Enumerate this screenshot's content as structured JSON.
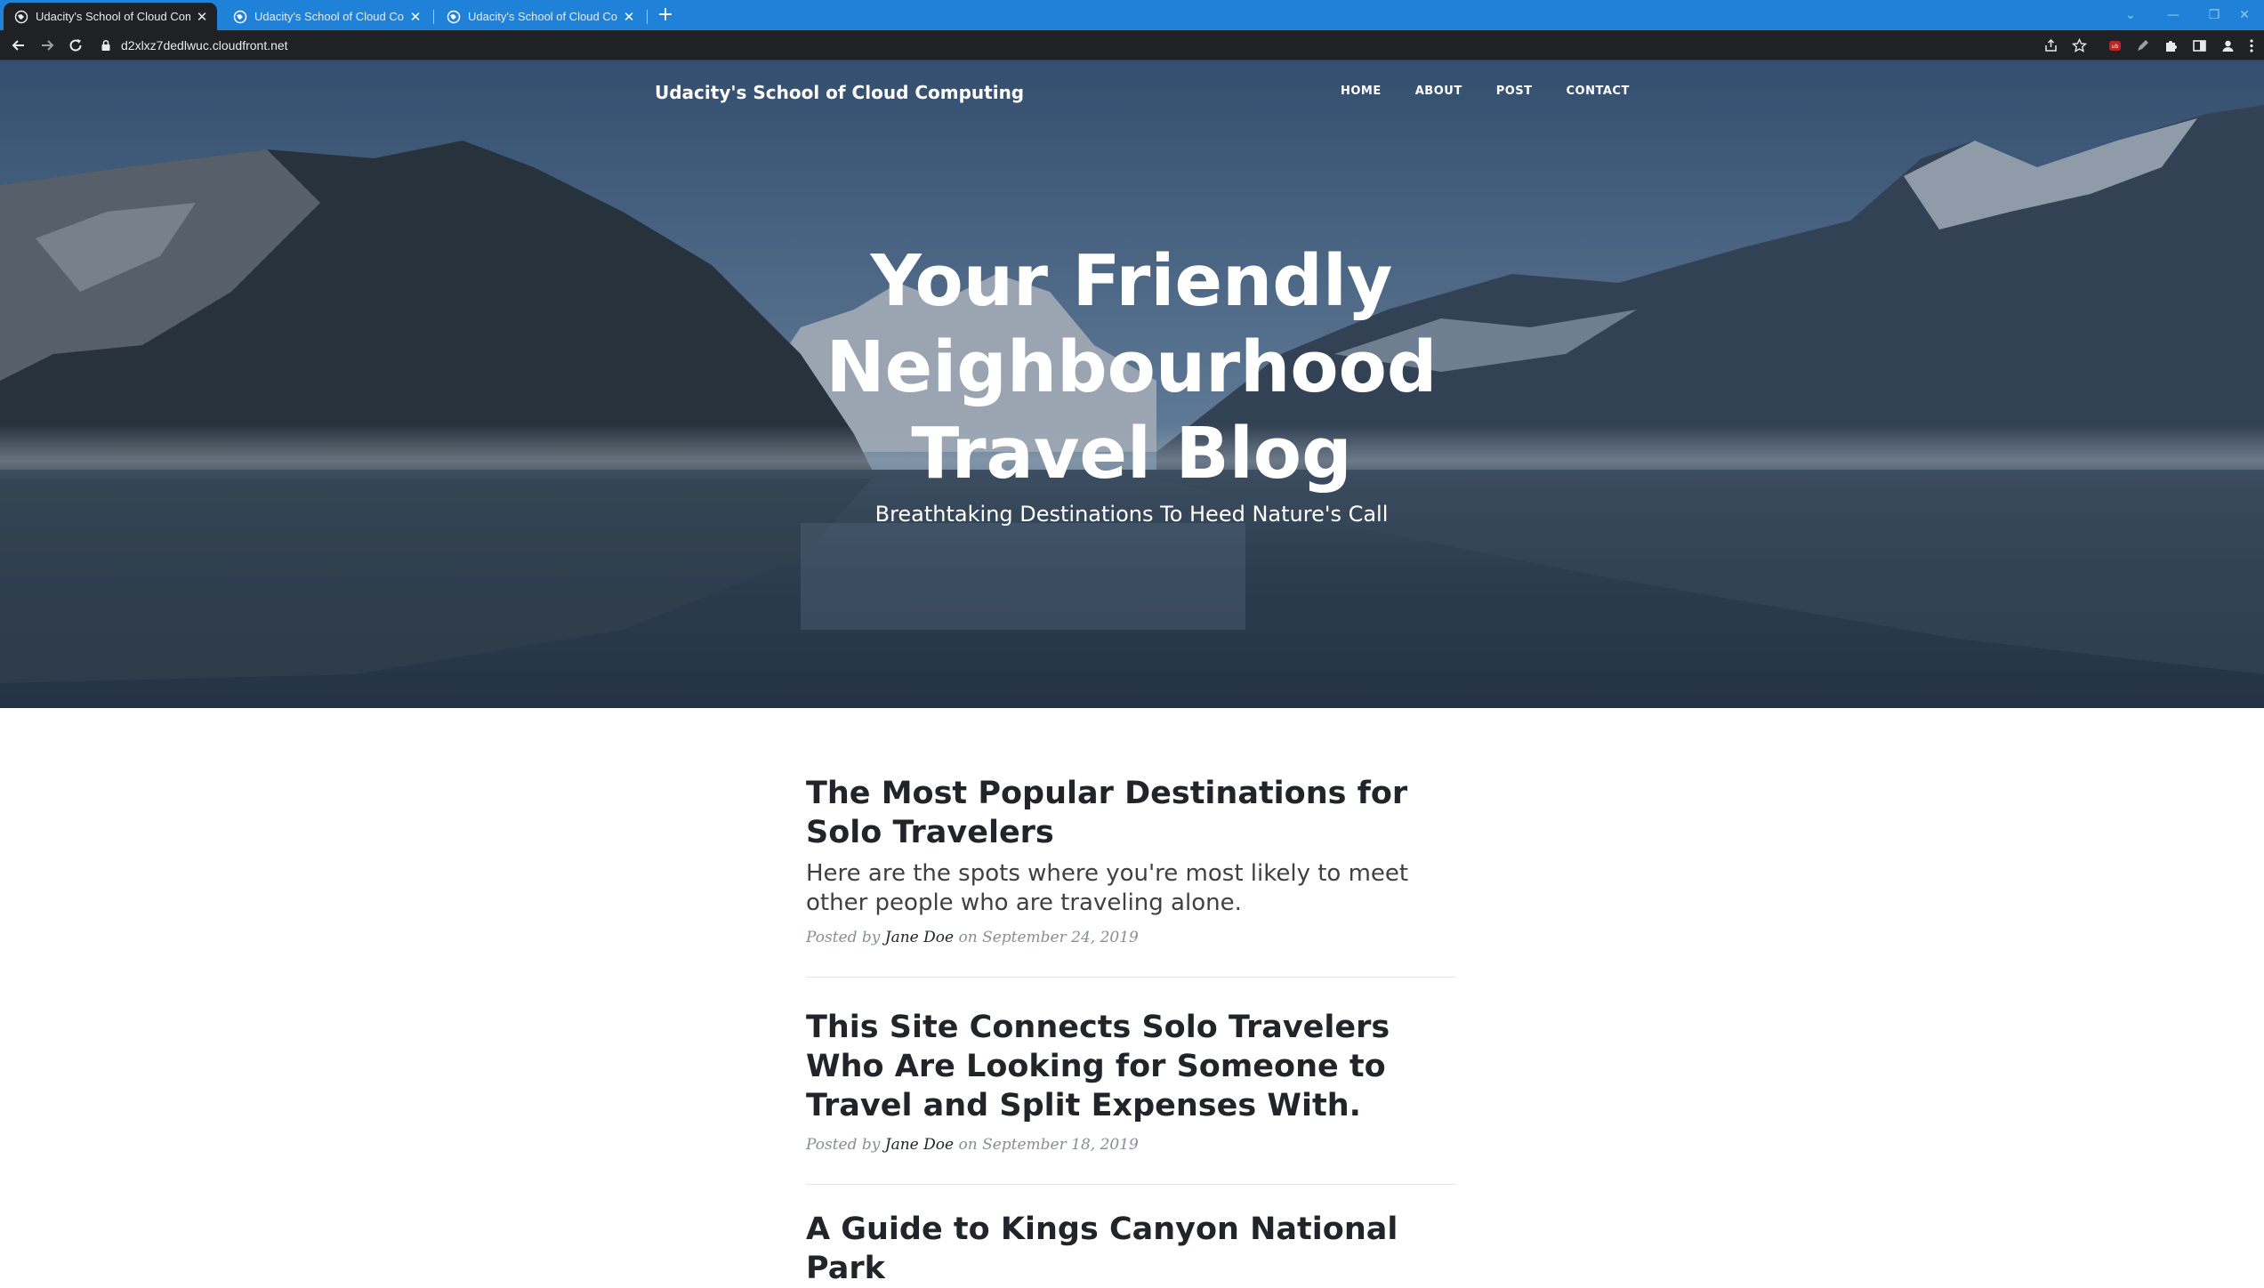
{
  "browser": {
    "tabs": [
      {
        "title": "Udacity's School of Cloud Comp",
        "active": true
      },
      {
        "title": "Udacity's School of Cloud Comp",
        "active": false
      },
      {
        "title": "Udacity's School of Cloud Comp",
        "active": false
      }
    ],
    "url": "d2xlxz7dedlwuc.cloudfront.net"
  },
  "site": {
    "brand": "Udacity's School of Cloud Computing",
    "nav": [
      "HOME",
      "ABOUT",
      "POST",
      "CONTACT"
    ]
  },
  "hero": {
    "title_lines": [
      "Your Friendly",
      "Neighbourhood",
      "Travel Blog"
    ],
    "subtitle": "Breathtaking Destinations To Heed Nature's Call"
  },
  "posts": [
    {
      "title": "The Most Popular Destinations for Solo Travelers",
      "subtitle": "Here are the spots where you're most likely to meet other people who are traveling alone.",
      "posted_by": "Posted by",
      "author": "Jane Doe",
      "on": "on",
      "date": "September 24, 2019"
    },
    {
      "title": "This Site Connects Solo Travelers Who Are Looking for Someone to Travel and Split Expenses With.",
      "subtitle": "",
      "posted_by": "Posted by",
      "author": "Jane Doe",
      "on": "on",
      "date": "September 18, 2019"
    },
    {
      "title": "A Guide to Kings Canyon National Park"
    }
  ],
  "colors": {
    "tabbar": "#1f82d8",
    "toolbar": "#202124",
    "heading": "#212529",
    "meta": "#868e96"
  }
}
